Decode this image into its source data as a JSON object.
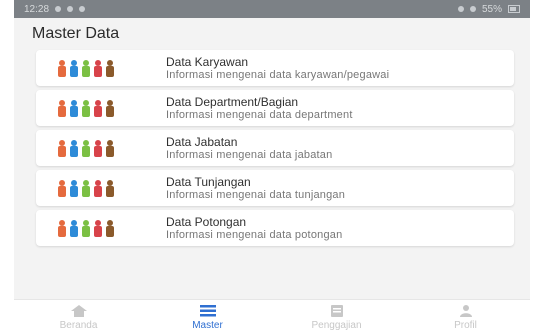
{
  "statusbar": {
    "time": "12:28",
    "right_text": "55%"
  },
  "header": {
    "title": "Master Data"
  },
  "menu": {
    "items": [
      {
        "title": "Data Karyawan",
        "subtitle": "Informasi mengenai data karyawan/pegawai",
        "icon": "people-group-icon"
      },
      {
        "title": "Data Department/Bagian",
        "subtitle": "Informasi mengenai data department",
        "icon": "people-group-icon"
      },
      {
        "title": "Data Jabatan",
        "subtitle": "Informasi mengenai data jabatan",
        "icon": "people-group-icon"
      },
      {
        "title": "Data Tunjangan",
        "subtitle": "Informasi mengenai data tunjangan",
        "icon": "people-group-icon"
      },
      {
        "title": "Data Potongan",
        "subtitle": "Informasi mengenai data potongan",
        "icon": "people-group-icon"
      }
    ]
  },
  "navbar": {
    "items": [
      {
        "label": "Beranda",
        "icon": "home-icon"
      },
      {
        "label": "Master",
        "icon": "list-icon"
      },
      {
        "label": "Penggajian",
        "icon": "payroll-icon"
      },
      {
        "label": "Profil",
        "icon": "user-icon"
      }
    ],
    "active_color": "#2f6fd1"
  }
}
